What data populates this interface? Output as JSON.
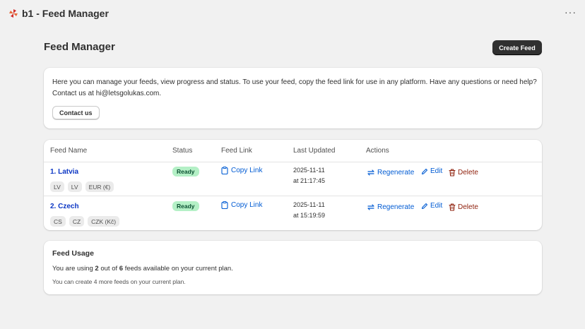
{
  "app": {
    "title": "b1 - Feed Manager",
    "logo_icon": "pinwheel-logo-icon",
    "menu_icon": "more-horizontal-icon",
    "menu_glyph": "···"
  },
  "header": {
    "title": "Feed Manager",
    "create_button_label": "Create Feed"
  },
  "intro": {
    "text": "Here you can manage your feeds, view progress and status. To use your feed, copy the feed link for use in any platform. Have any questions or need help? Contact us at hi@letsgolukas.com.",
    "contact_button_label": "Contact us"
  },
  "table": {
    "columns": [
      "Feed Name",
      "Status",
      "Feed Link",
      "Last Updated",
      "Actions"
    ],
    "rows": [
      {
        "name": "1. Latvia",
        "tags": [
          "LV",
          "LV",
          "EUR (€)"
        ],
        "status": "Ready",
        "link_label": "Copy Link",
        "updated_date": "2025-11-11",
        "updated_time": "at 21:17:45",
        "actions": {
          "regenerate": "Regenerate",
          "edit": "Edit",
          "delete": "Delete"
        }
      },
      {
        "name": "2. Czech",
        "tags": [
          "CS",
          "CZ",
          "CZK (Kč)"
        ],
        "status": "Ready",
        "link_label": "Copy Link",
        "updated_date": "2025-11-11",
        "updated_time": "at 15:19:59",
        "actions": {
          "regenerate": "Regenerate",
          "edit": "Edit",
          "delete": "Delete"
        }
      }
    ]
  },
  "usage": {
    "title": "Feed Usage",
    "line_prefix": "You are using",
    "used": "2",
    "line_middle": "out of",
    "total": "6",
    "line_suffix": "feeds available on your current plan.",
    "sub": "You can create 4 more feeds on your current plan."
  },
  "colors": {
    "link": "#005bd3",
    "feed_name": "#0b36c4",
    "delete": "#8e1f0b",
    "ready_bg": "#b4f0c6",
    "ready_text": "#0c5132",
    "primary_button": "#303030"
  }
}
